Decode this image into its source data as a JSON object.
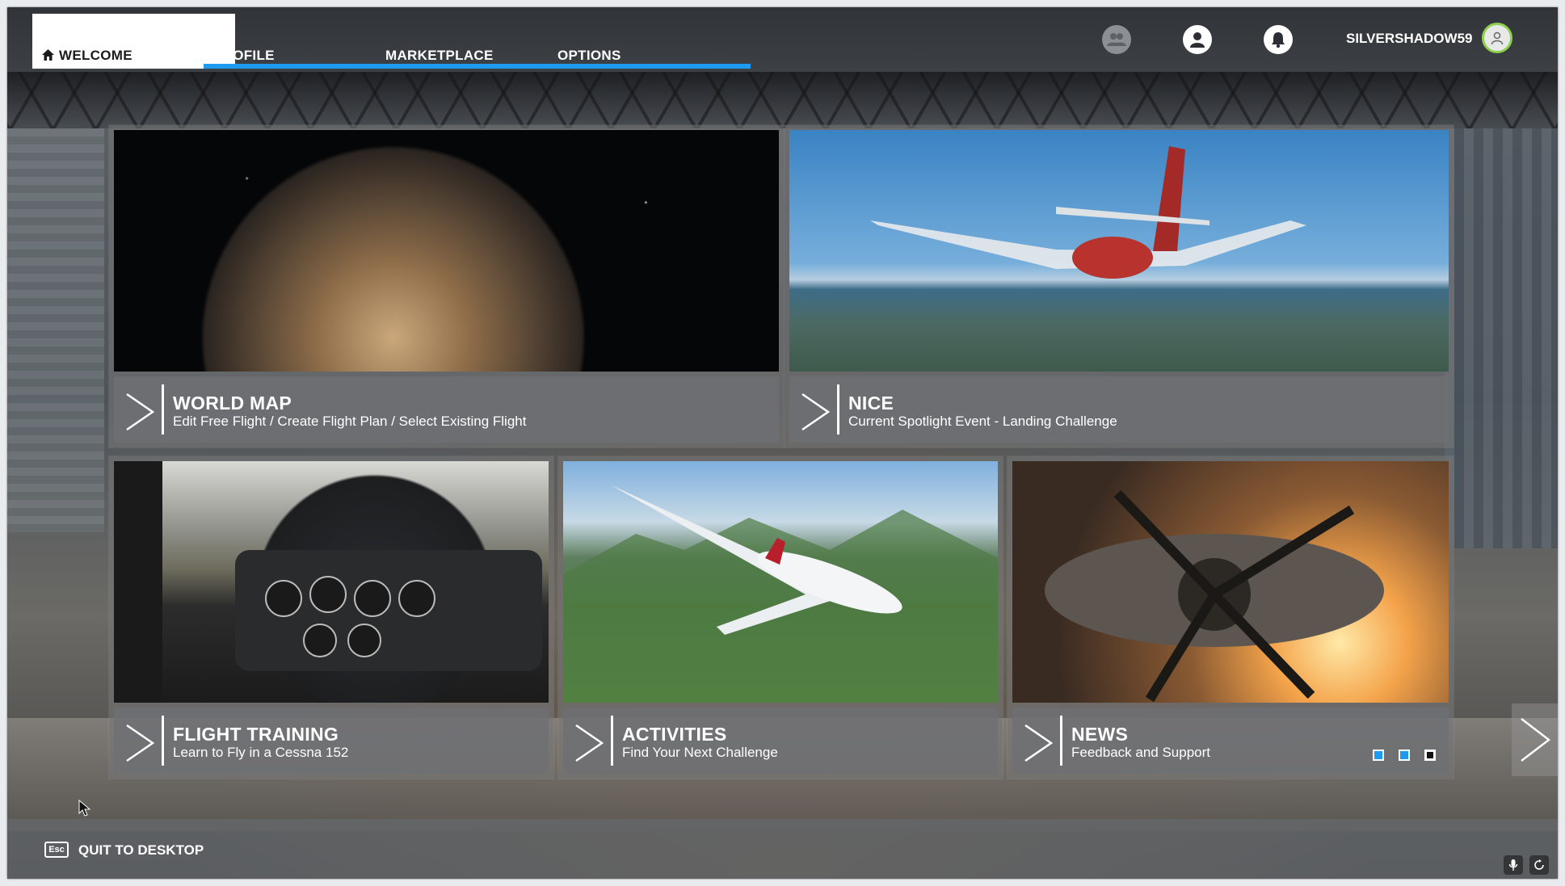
{
  "nav": {
    "tabs": [
      {
        "label": "WELCOME",
        "active": true
      },
      {
        "label": "PROFILE",
        "active": false
      },
      {
        "label": "MARKETPLACE",
        "active": false
      },
      {
        "label": "OPTIONS",
        "active": false
      }
    ],
    "username": "SILVERSHADOW59",
    "icons": [
      "friends-icon",
      "profile-icon",
      "notifications-icon",
      "avatar-icon"
    ]
  },
  "cards": [
    {
      "title": "WORLD MAP",
      "subtitle": "Edit Free Flight / Create Flight Plan / Select Existing Flight"
    },
    {
      "title": "NICE",
      "subtitle": "Current Spotlight Event - Landing Challenge"
    },
    {
      "title": "FLIGHT TRAINING",
      "subtitle": "Learn to Fly in a Cessna 152"
    },
    {
      "title": "ACTIVITIES",
      "subtitle": "Find Your Next Challenge"
    },
    {
      "title": "NEWS",
      "subtitle": "Feedback and Support",
      "page_dots": 3,
      "active_dot": 3
    }
  ],
  "footer": {
    "esc_key": "Esc",
    "quit_label": "QUIT TO DESKTOP"
  },
  "colors": {
    "accent": "#1e9bf0",
    "avatar_ring": "#8ed04c"
  }
}
